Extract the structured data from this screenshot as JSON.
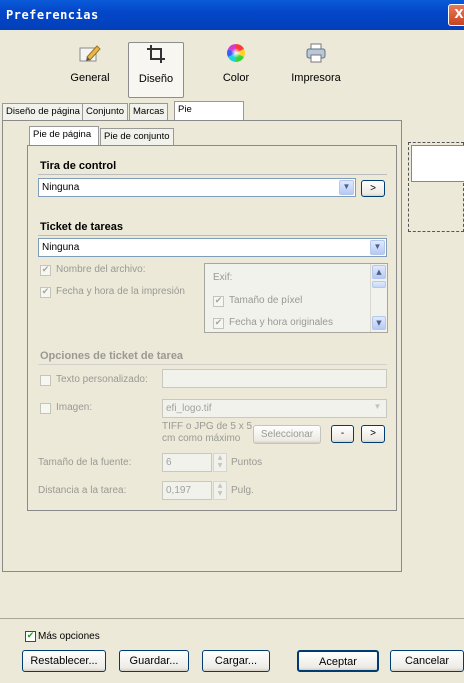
{
  "window": {
    "title": "Preferencias",
    "close": "X"
  },
  "categories": [
    {
      "label": "General"
    },
    {
      "label": "Diseño"
    },
    {
      "label": "Color"
    },
    {
      "label": "Impresora"
    }
  ],
  "tabs_main": [
    "Diseño de página",
    "Conjunto",
    "Marcas",
    "Pie"
  ],
  "tabs_sub": [
    "Pie de página",
    "Pie de conjunto"
  ],
  "tira": {
    "title": "Tira de control",
    "value": "Ninguna",
    "arrow": ">"
  },
  "ticket": {
    "title": "Ticket de tareas",
    "value": "Ninguna",
    "opt_filename": "Nombre del archivo:",
    "opt_datetime": "Fecha y hora de la impresión",
    "exif_title": "Exif:",
    "exif_items": [
      "Tamaño de píxel",
      "Fecha y hora originales"
    ]
  },
  "opciones": {
    "title": "Opciones de ticket de tarea",
    "texto_label": "Texto personalizado:",
    "texto_value": "",
    "imagen_label": "Imagen:",
    "imagen_value": "efi_logo.tif",
    "imagen_hint_1": "TIFF o JPG de 5 x 5",
    "imagen_hint_2": "cm como máximo",
    "seleccionar": "Seleccionar",
    "minus": "-",
    "arrow": ">",
    "font_label": "Tamaño de la fuente:",
    "font_value": "6",
    "font_unit": "Puntos",
    "dist_label": "Distancia a la tarea:",
    "dist_value": "0,197",
    "dist_unit": "Pulg."
  },
  "footer": {
    "mas_opciones": "Más opciones",
    "restablecer": "Restablecer...",
    "guardar": "Guardar...",
    "cargar": "Cargar...",
    "aceptar": "Aceptar",
    "cancelar": "Cancelar"
  }
}
